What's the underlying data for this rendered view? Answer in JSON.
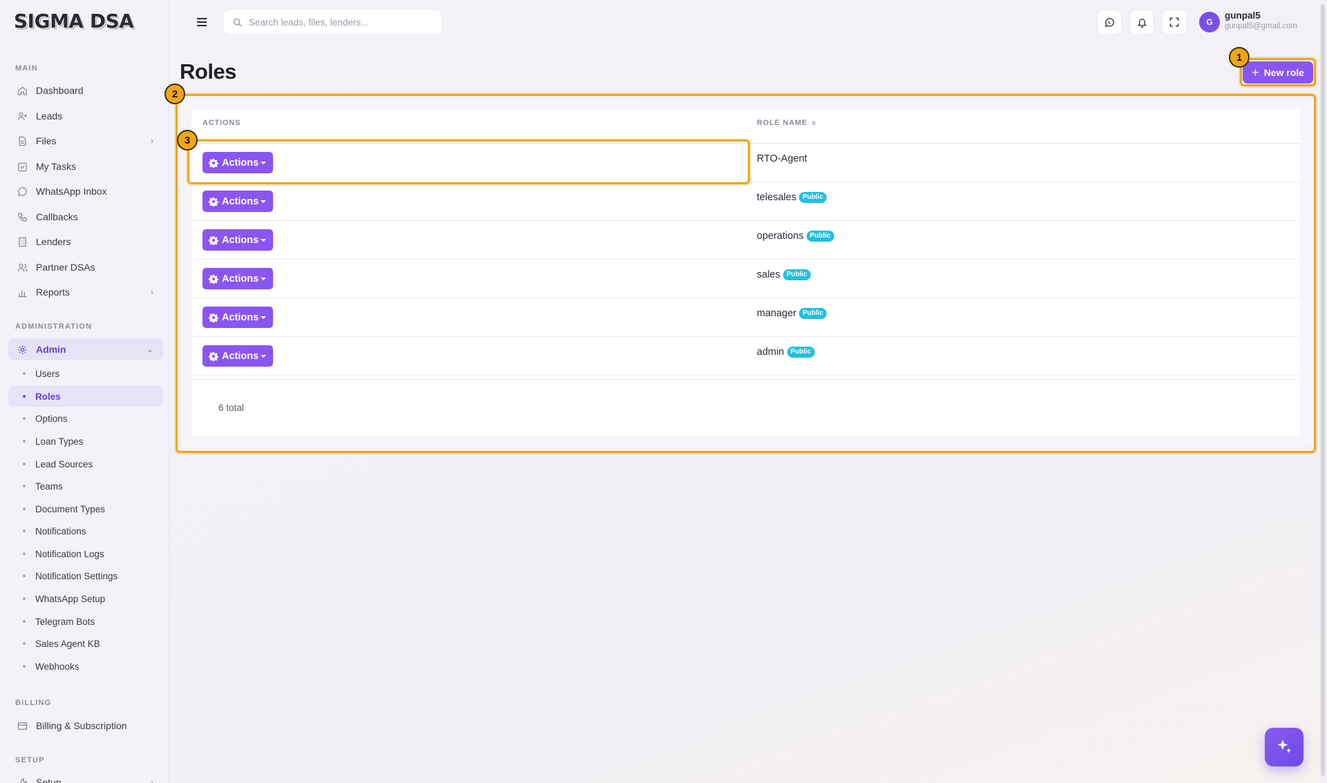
{
  "app": {
    "logo_text": "SIGMA DSA"
  },
  "sidebar": {
    "sections": {
      "main": "MAIN",
      "administration": "ADMINISTRATION",
      "billing": "BILLING",
      "setup": "SETUP"
    },
    "main_items": [
      {
        "label": "Dashboard",
        "icon": "home-icon"
      },
      {
        "label": "Leads",
        "icon": "user-plus-icon"
      },
      {
        "label": "Files",
        "icon": "file-icon",
        "has_children": true
      },
      {
        "label": "My Tasks",
        "icon": "checkbox-icon"
      },
      {
        "label": "WhatsApp Inbox",
        "icon": "whatsapp-icon"
      },
      {
        "label": "Callbacks",
        "icon": "phone-icon"
      },
      {
        "label": "Lenders",
        "icon": "building-icon"
      },
      {
        "label": "Partner DSAs",
        "icon": "users-icon"
      },
      {
        "label": "Reports",
        "icon": "bar-chart-icon",
        "has_children": true
      }
    ],
    "admin": {
      "label": "Admin",
      "icon": "gear-icon",
      "expanded": true
    },
    "admin_items": [
      {
        "label": "Users"
      },
      {
        "label": "Roles",
        "active": true
      },
      {
        "label": "Options"
      },
      {
        "label": "Loan Types"
      },
      {
        "label": "Lead Sources"
      },
      {
        "label": "Teams"
      },
      {
        "label": "Document Types"
      },
      {
        "label": "Notifications"
      },
      {
        "label": "Notification Logs"
      },
      {
        "label": "Notification Settings"
      },
      {
        "label": "WhatsApp Setup"
      },
      {
        "label": "Telegram Bots"
      },
      {
        "label": "Sales Agent KB"
      },
      {
        "label": "Webhooks"
      }
    ],
    "billing_item": {
      "label": "Billing & Subscription",
      "icon": "credit-card-icon"
    },
    "setup_item": {
      "label": "Setup",
      "icon": "wrench-icon"
    }
  },
  "topbar": {
    "search_placeholder": "Search leads, files, lenders...",
    "user": {
      "initial": "G",
      "name": "gunpal5",
      "email": "gunpal5@gmail.com"
    }
  },
  "page": {
    "title": "Roles",
    "new_button_label": "New role",
    "columns": {
      "actions": "ACTIONS",
      "role_name": "ROLE NAME"
    },
    "action_label": "Actions",
    "rows": [
      {
        "name": "RTO-Agent",
        "badge": ""
      },
      {
        "name": "telesales",
        "badge": "Public"
      },
      {
        "name": "operations",
        "badge": "Public"
      },
      {
        "name": "sales",
        "badge": "Public"
      },
      {
        "name": "manager",
        "badge": "Public"
      },
      {
        "name": "admin",
        "badge": "Public"
      }
    ],
    "total_label": "6 total"
  },
  "annotations": {
    "markers": [
      "1",
      "2",
      "3"
    ],
    "color": "#f2a516"
  },
  "colors": {
    "accent": "#8a55f0",
    "badge": "#22bfe0",
    "active_bg": "#e7e3f6"
  }
}
